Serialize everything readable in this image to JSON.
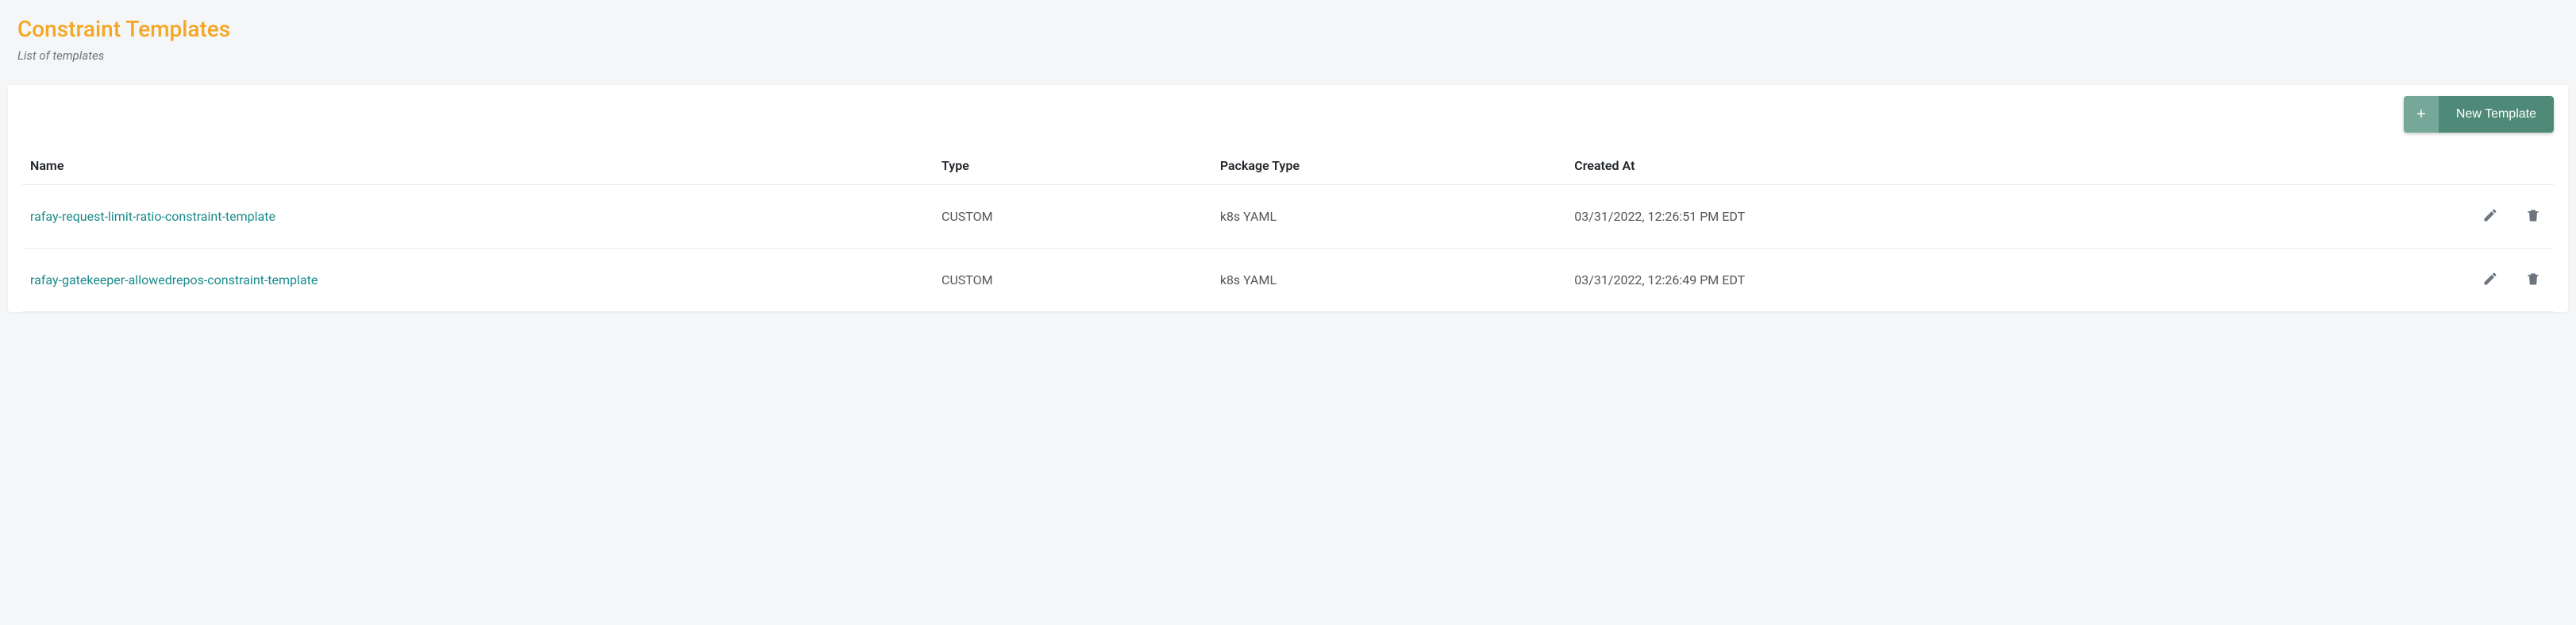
{
  "header": {
    "title": "Constraint Templates",
    "subtitle": "List of templates"
  },
  "toolbar": {
    "new_button_label": "New Template"
  },
  "table": {
    "columns": {
      "name": "Name",
      "type": "Type",
      "package_type": "Package Type",
      "created_at": "Created At"
    },
    "rows": [
      {
        "name": "rafay-request-limit-ratio-constraint-template",
        "type": "CUSTOM",
        "package_type": "k8s YAML",
        "created_at": "03/31/2022, 12:26:51 PM EDT"
      },
      {
        "name": "rafay-gatekeeper-allowedrepos-constraint-template",
        "type": "CUSTOM",
        "package_type": "k8s YAML",
        "created_at": "03/31/2022, 12:26:49 PM EDT"
      }
    ]
  }
}
